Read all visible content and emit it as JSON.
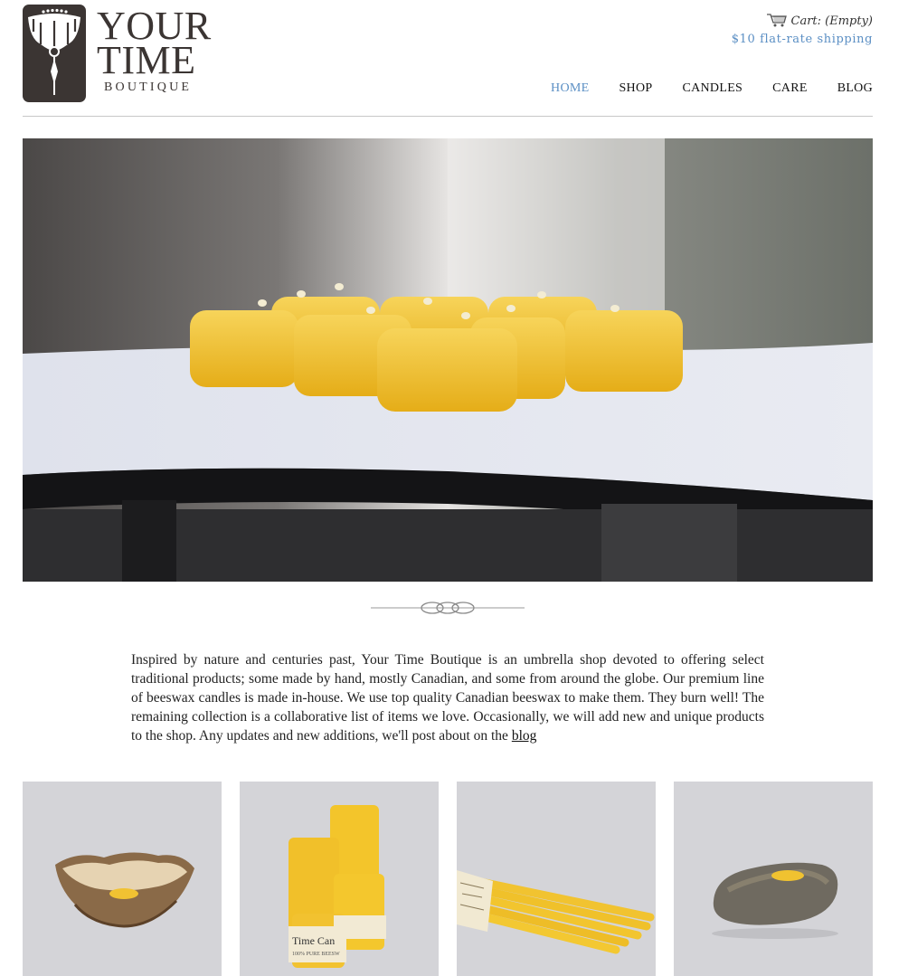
{
  "brand": {
    "line1": "YOUR",
    "line2": "TIME",
    "subtitle": "BOUTIQUE"
  },
  "cart": {
    "label": "Cart: (Empty)",
    "shipping": "$10 flat-rate shipping"
  },
  "nav": {
    "items": [
      {
        "label": "HOME",
        "active": true
      },
      {
        "label": "SHOP",
        "active": false
      },
      {
        "label": "CANDLES",
        "active": false
      },
      {
        "label": "CARE",
        "active": false
      },
      {
        "label": "BLOG",
        "active": false
      }
    ]
  },
  "intro": {
    "text": "Inspired by nature and centuries past, Your Time Boutique is an umbrella shop devoted to offering select traditional products; some made by hand, mostly Canadian, and some from around the globe. Our premium line of beeswax candles is made in-house. We use top quality Canadian beeswax to make them. They burn well! The remaining collection is a collaborative list of items we love. Occasionally, we will add new and unique products to the shop. Any updates and new additions, we'll post about on the ",
    "link": "blog"
  },
  "products": {
    "tile2_label": "Time Can",
    "tile2_sublabel": "100% PURE BEESW"
  },
  "colors": {
    "accent": "#5b8fc4",
    "logo_bg": "#3b3533",
    "candle": "#f2c22f",
    "tile_bg": "#d3d3d7"
  },
  "icons": [
    "cart-icon",
    "logo-flower-icon",
    "ornament-divider-icon"
  ]
}
